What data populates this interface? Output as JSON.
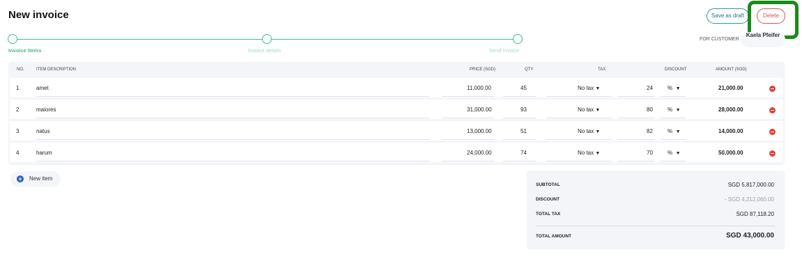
{
  "header": {
    "title": "New invoice",
    "save_draft_label": "Save as draft",
    "delete_label": "Delete"
  },
  "stepper": {
    "steps": [
      {
        "label": "Invoice Items",
        "state": "active"
      },
      {
        "label": "Invoice details",
        "state": "pending"
      },
      {
        "label": "Send Invoice",
        "state": "pending"
      }
    ]
  },
  "customer": {
    "label": "FOR CUSTOMER",
    "name": "Kaela Pfeifer"
  },
  "table": {
    "headers": {
      "no": "NO.",
      "description": "ITEM DESCRIPTION",
      "price": "PRICE (SGD)",
      "qty": "QTY",
      "tax": "TAX",
      "discount": "DISCOUNT",
      "amount": "AMOUNT (SGD)"
    },
    "rows": [
      {
        "no": "1",
        "description": "amet",
        "price": "11,000.00",
        "qty": "45",
        "tax": "No tax",
        "discount": "24",
        "discount_unit": "%",
        "amount": "21,000.00"
      },
      {
        "no": "2",
        "description": "maiores",
        "price": "31,000.00",
        "qty": "93",
        "tax": "No tax",
        "discount": "80",
        "discount_unit": "%",
        "amount": "28,000.00"
      },
      {
        "no": "3",
        "description": "natus",
        "price": "13,000.00",
        "qty": "51",
        "tax": "No tax",
        "discount": "82",
        "discount_unit": "%",
        "amount": "14,000.00"
      },
      {
        "no": "4",
        "description": "harum",
        "price": "24,000.00",
        "qty": "74",
        "tax": "No tax",
        "discount": "70",
        "discount_unit": "%",
        "amount": "50,000.00"
      }
    ]
  },
  "new_item_label": "New item",
  "totals": {
    "subtotal_label": "SUBTOTAL",
    "subtotal_value": "SGD 5,817,000.00",
    "discount_label": "DISCOUNT",
    "discount_value": "- SGD 4,212,060.00",
    "total_tax_label": "TOTAL TAX",
    "total_tax_value": "SGD 87,118.20",
    "total_amount_label": "TOTAL AMOUNT",
    "total_amount_value": "SGD 43,000.00"
  },
  "colors": {
    "accent_green": "#3fbf8f",
    "delete_red": "#d9534f",
    "highlight_green": "#1a8a1a",
    "plus_blue": "#2b63c5"
  },
  "icons": {
    "remove": "minus-circle-icon",
    "add": "plus-circle-icon",
    "dropdown": "caret-down-icon"
  }
}
